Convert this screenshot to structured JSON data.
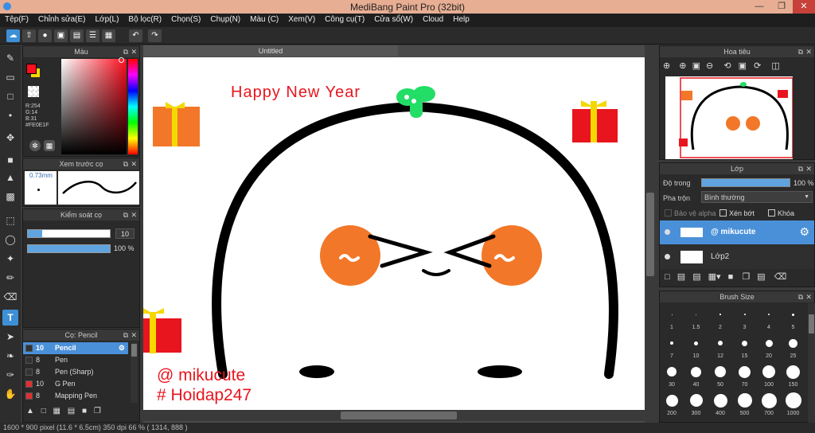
{
  "app": {
    "title": "MediBang Paint Pro (32bit)"
  },
  "menu": [
    "Tệp(F)",
    "Chỉnh sửa(E)",
    "Lớp(L)",
    "Bộ lọc(R)",
    "Chọn(S)",
    "Chụp(N)",
    "Màu (C)",
    "Xem(V)",
    "Công cụ(T)",
    "Cửa sổ(W)",
    "Cloud",
    "Help"
  ],
  "color_panel": {
    "title": "Màu",
    "r": "R:254",
    "g": "G:14",
    "b": "B:31",
    "hex": "#FE0E1F",
    "fg": "#fe0e1f",
    "bg": "#f5d800"
  },
  "brush_preview": {
    "title": "Xem trước cọ",
    "size": "0.73mm"
  },
  "brush_control": {
    "title": "Kiểm soát cọ",
    "size_value": "10",
    "opacity_value": "100 %"
  },
  "brush_list": {
    "title": "Cọ: Pencil",
    "items": [
      {
        "size": "10",
        "name": "Pencil",
        "color": "#333333",
        "active": true
      },
      {
        "size": "8",
        "name": "Pen",
        "color": "#333333"
      },
      {
        "size": "8",
        "name": "Pen (Sharp)",
        "color": "#333333"
      },
      {
        "size": "10",
        "name": "G Pen",
        "color": "#e03030"
      },
      {
        "size": "8",
        "name": "Mapping Pen",
        "color": "#e03030"
      }
    ]
  },
  "document": {
    "tab": "Untitled"
  },
  "drawing": {
    "headline": "Happy New Year",
    "signature1": "@ mikucute",
    "signature2": "# Hoidap247"
  },
  "navigator": {
    "title": "Hoa tiêu"
  },
  "layers": {
    "title": "Lớp",
    "opacity_label": "Độ trong",
    "opacity_value": "100 %",
    "blend_label": "Pha trộn",
    "blend_value": "Bình thường",
    "protect_alpha": "Bảo vệ alpha",
    "clip": "Xén bớt",
    "lock": "Khóa",
    "items": [
      {
        "name": "@ mikucute",
        "active": true
      },
      {
        "name": "Lớp2",
        "active": false
      }
    ]
  },
  "brush_size": {
    "title": "Brush Size",
    "labels": [
      "1",
      "1.5",
      "2",
      "3",
      "4",
      "5",
      "7",
      "10",
      "12",
      "15",
      "20",
      "25",
      "30",
      "40",
      "50",
      "70",
      "100",
      "150",
      "200",
      "300",
      "400",
      "500",
      "700",
      "1000"
    ]
  },
  "status": {
    "text": "1600 * 900 pixel   (11.6 * 6.5cm)   350 dpi   66 %   ( 1314, 888 )"
  }
}
